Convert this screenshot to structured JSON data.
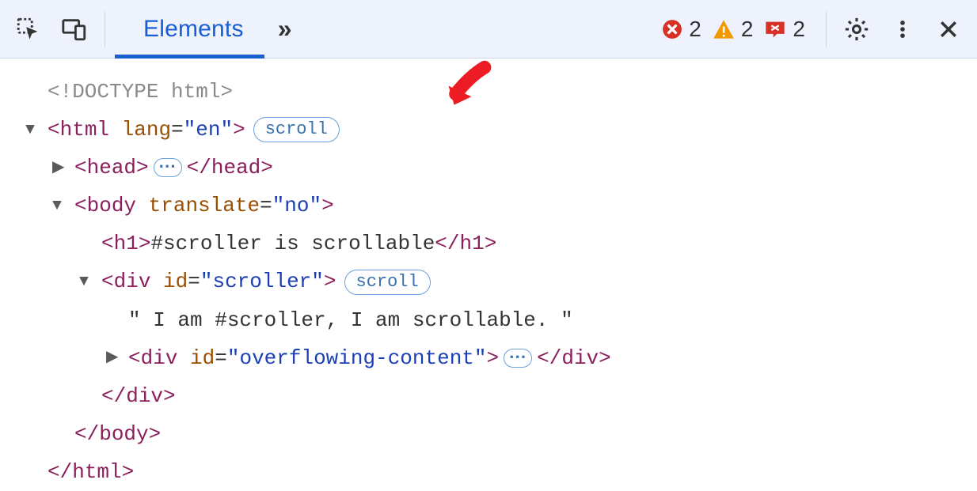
{
  "toolbar": {
    "tab_elements": "Elements",
    "more_tabs": "»",
    "error_count": "2",
    "warning_count": "2",
    "issue_count": "2"
  },
  "badges": {
    "scroll": "scroll",
    "ellipsis": "⋯"
  },
  "dom": {
    "doctype": "<!DOCTYPE html>",
    "html_open_tag": "html",
    "html_lang_attr": "lang",
    "html_lang_val": "\"en\"",
    "head_tag": "head",
    "body_tag": "body",
    "body_attr": "translate",
    "body_val": "\"no\"",
    "h1_tag": "h1",
    "h1_text": "#scroller is scrollable",
    "div_tag": "div",
    "id_attr": "id",
    "scroller_val": "\"scroller\"",
    "scroller_text": "\" I am #scroller, I am scrollable. \"",
    "overflow_val": "\"overflowing-content\""
  }
}
